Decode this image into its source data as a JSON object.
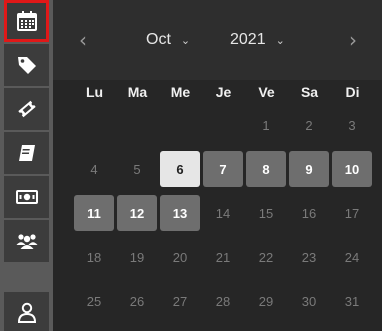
{
  "sidebar": {
    "items": [
      {
        "name": "calendar",
        "icon": "calendar-icon",
        "active": true
      },
      {
        "name": "tag",
        "icon": "tag-icon",
        "active": false
      },
      {
        "name": "ticket",
        "icon": "ticket-icon",
        "active": false
      },
      {
        "name": "notebook",
        "icon": "notebook-icon",
        "active": false
      },
      {
        "name": "money",
        "icon": "banknote-icon",
        "active": false
      },
      {
        "name": "people",
        "icon": "group-icon",
        "active": false
      },
      {
        "name": "user",
        "icon": "user-icon",
        "active": false
      }
    ]
  },
  "calendar": {
    "prev": "‹",
    "next": "›",
    "month": "Oct",
    "year": "2021",
    "weekdays": [
      "Lu",
      "Ma",
      "Me",
      "Je",
      "Ve",
      "Sa",
      "Di"
    ],
    "weeks": [
      [
        null,
        null,
        null,
        null,
        "1",
        "2",
        "3"
      ],
      [
        "4",
        "5",
        "6",
        "7",
        "8",
        "9",
        "10"
      ],
      [
        "11",
        "12",
        "13",
        "14",
        "15",
        "16",
        "17"
      ],
      [
        "18",
        "19",
        "20",
        "21",
        "22",
        "23",
        "24"
      ],
      [
        "25",
        "26",
        "27",
        "28",
        "29",
        "30",
        "31"
      ]
    ],
    "today": "6",
    "available": [
      "7",
      "8",
      "9",
      "10",
      "11",
      "12",
      "13"
    ]
  },
  "colors": {
    "accent_outline": "#e01818",
    "available_bg": "#6e6e6e",
    "today_bg": "#e6e6e6"
  }
}
